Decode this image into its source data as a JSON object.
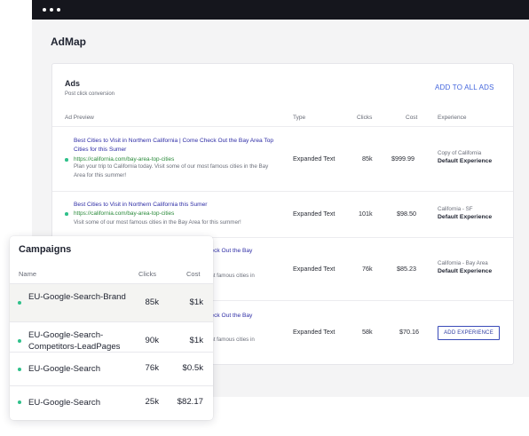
{
  "app": {
    "title": "AdMap"
  },
  "ads": {
    "title": "Ads",
    "subtitle": "Post click conversion",
    "add_all_label": "ADD TO ALL ADS",
    "columns": {
      "preview": "Ad Preview",
      "type": "Type",
      "clicks": "Clicks",
      "cost": "Cost",
      "experience": "Experience"
    },
    "rows": [
      {
        "title": "Best Cities to Visit in Northern California | Come Check Out the Bay Area Top Cities for this Sumer",
        "url": "https://california.com/bay-area-top-cities",
        "description": "Plan your trip to California today. Visit some of our most famous cities in the Bay Area for this summer!",
        "type": "Expanded Text",
        "clicks": "85k",
        "cost": "$999.99",
        "experience_name": "Copy of California",
        "experience_value": "Default Experience"
      },
      {
        "title": "Best Cities to Visit in Northern California this Sumer",
        "url": "https://california.com/bay-area-top-cities",
        "description": "Visit some of our most famous cities in the Bay Area for this summer!",
        "type": "Expanded Text",
        "clicks": "101k",
        "cost": "$98.50",
        "experience_name": "California - SF",
        "experience_value": "Default Experience"
      },
      {
        "title": "Check Out the Bay",
        "description": "most famous cities in",
        "type": "Expanded Text",
        "clicks": "76k",
        "cost": "$85.23",
        "experience_name": "California - Bay Area",
        "experience_value": "Default Experience"
      },
      {
        "title": "Check Out the Bay",
        "description": "most famous cities in",
        "type": "Expanded Text",
        "clicks": "58k",
        "cost": "$70.16",
        "experience_button": "ADD EXPERIENCE"
      }
    ]
  },
  "campaigns": {
    "title": "Campaigns",
    "columns": {
      "name": "Name",
      "clicks": "Clicks",
      "cost": "Cost"
    },
    "rows": [
      {
        "name": "EU-Google-Search-Brand",
        "clicks": "85k",
        "cost": "$1k"
      },
      {
        "name": "EU-Google-Search-Competitors-LeadPages",
        "clicks": "90k",
        "cost": "$1k"
      },
      {
        "name": "EU-Google-Search",
        "clicks": "76k",
        "cost": "$0.5k"
      },
      {
        "name": "EU-Google-Search",
        "clicks": "25k",
        "cost": "$82.17"
      }
    ]
  },
  "colors": {
    "accent": "#4466dd",
    "status": "#2fc08a",
    "ad_title": "#2c2ba5",
    "ad_url": "#2a8a3a",
    "titlebar": "#15161d"
  }
}
